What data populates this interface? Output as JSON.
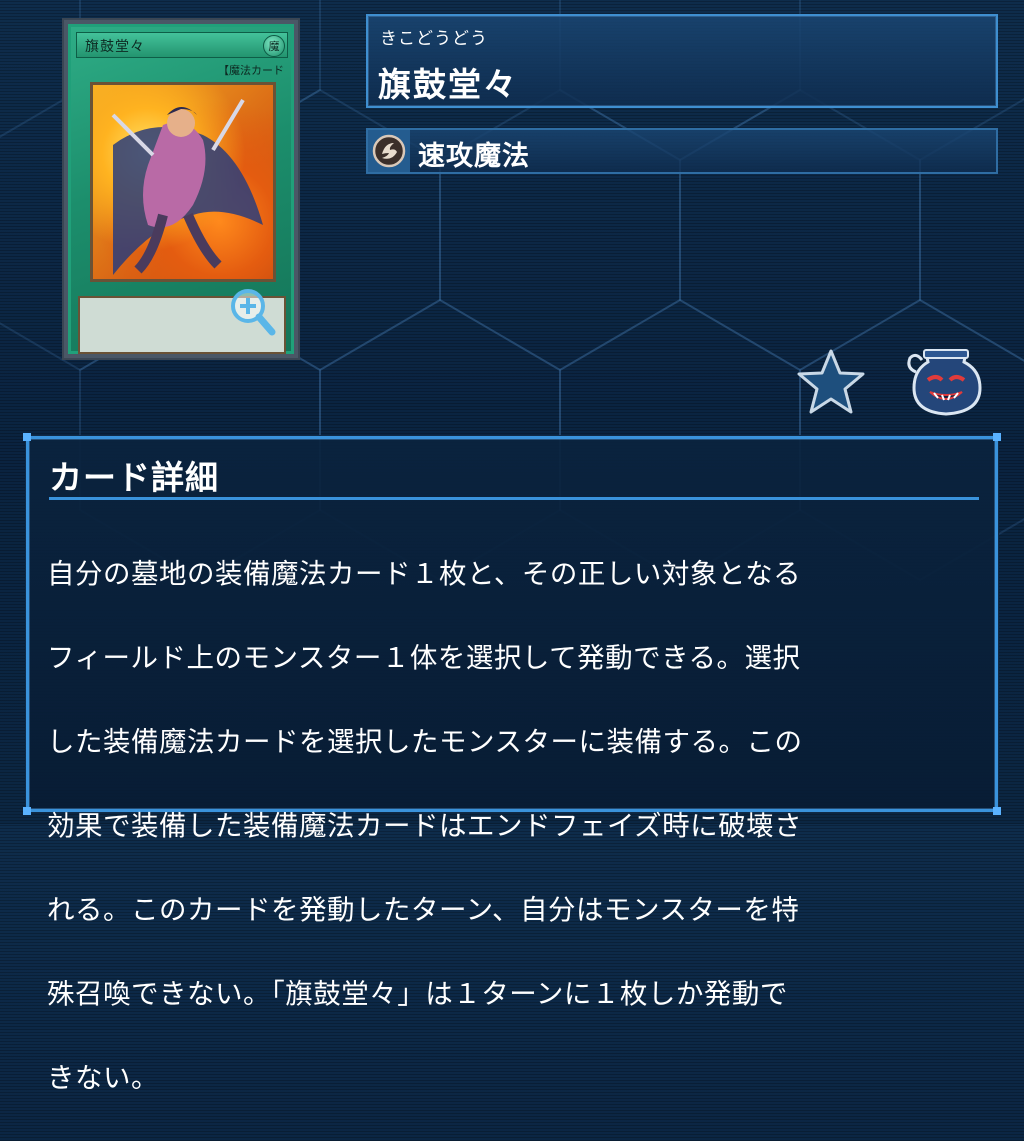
{
  "card": {
    "name": "旗鼓堂々",
    "furigana": "きこどうどう",
    "type": "速攻魔法",
    "type_icon": "quick-play-spell-icon",
    "printed_name": "旗鼓堂々",
    "printed_attribute": "魔",
    "printed_type_line": "【魔法カード",
    "zoom_icon": "zoom-in-icon"
  },
  "actions": {
    "favorite_icon": "star-icon",
    "pot_icon": "pot-of-greed-icon"
  },
  "details": {
    "title": "カード詳細",
    "lines": [
      "自分の墓地の装備魔法カード１枚と、その正しい対象となる",
      "フィールド上のモンスター１体を選択して発動できる。選択",
      "した装備魔法カードを選択したモンスターに装備する。この",
      "効果で装備した装備魔法カードはエンドフェイズ時に破壊さ",
      "れる。このカードを発動したターン、自分はモンスターを特",
      "殊召喚できない。「旗鼓堂々」は１ターンに１枚しか発動で",
      "きない。"
    ]
  },
  "colors": {
    "background": "#0c2744",
    "panel_border": "#3a93dc",
    "card_frame": "#1c8e6c",
    "star": "#1e4f7d"
  }
}
